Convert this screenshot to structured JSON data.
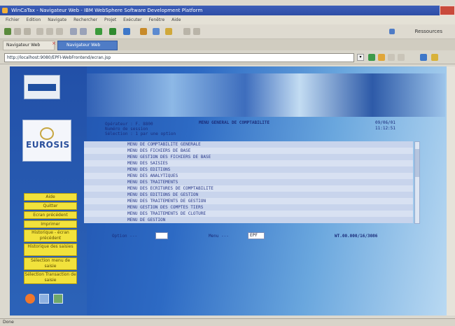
{
  "window": {
    "title": "WinCaTax - Navigateur Web - IBM WebSphere Software Development Platform"
  },
  "menubar": {
    "items": [
      "Fichier",
      "Edition",
      "Navigate",
      "Rechercher",
      "Projet",
      "Exécuter",
      "Fenêtre",
      "Aide"
    ]
  },
  "toolbar": {
    "perspective_label": "Ressources"
  },
  "tabs": [
    {
      "label": "Navigateur Web"
    },
    {
      "label": "Navigateur Web"
    }
  ],
  "address": {
    "url": "http://localhost:9080/EPFI-WebFrontend/ecran.jsp"
  },
  "sidebar": {
    "logo_text": "EUROSIS",
    "buttons": [
      "Aide",
      "Quitter",
      "Ecran précédent",
      "Imprimer",
      "Historique - écran précédent",
      "Historique des saisies",
      "Sélection menu de saisie",
      "Sélection Transaction de saisie"
    ]
  },
  "header": {
    "left_line1": "Opérateur : F. 8800",
    "left_line2": "Numéro de session",
    "left_line3": "Sélection : 1 par une option",
    "title": "MENU GENERAL DE COMPTABILITE",
    "date": "09/06/01",
    "time": "11:12:51"
  },
  "menu_list": [
    "MENU DE COMPTABILITE GENERALE",
    "MENU DES FICHIERS DE BASE",
    "MENU GESTION DES FICHIERS DE BASE",
    "MENU DES SAISIES",
    "MENU DES EDITIONS",
    "MENU DES ANALYTIQUES",
    "MENU DES TRAITEMENTS",
    "MENU DES ECRITURES DE COMPTABILITE",
    "MENU DES EDITIONS DE GESTION",
    "MENU DES TRAITEMENTS DE GESTION",
    "MENU GESTION DES COMPTES TIERS",
    "MENU DES TRAITEMENTS DE CLOTURE",
    "MENU DE GESTION"
  ],
  "fields": {
    "option_label": "Option ---",
    "option_value": "",
    "menu_label": "Menu ---",
    "menu_value": "EPF",
    "code": "WT.00.000/16/3086"
  },
  "status": {
    "text": "Done"
  }
}
